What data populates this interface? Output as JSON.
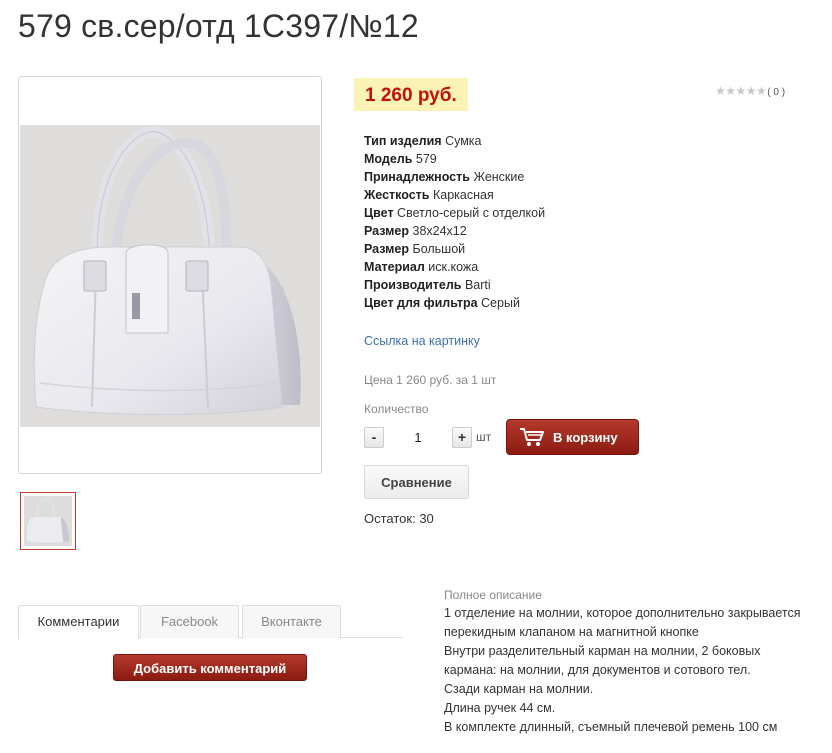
{
  "product": {
    "title": "579 св.сер/отд 1С397/№12",
    "price": "1 260 руб.",
    "rating_stars": "★★★★★",
    "rating_count": "( 0 )"
  },
  "properties": [
    {
      "key": "Тип изделия",
      "value": "Сумка"
    },
    {
      "key": "Модель",
      "value": "579"
    },
    {
      "key": "Принадлежность",
      "value": "Женские"
    },
    {
      "key": "Жесткость",
      "value": "Каркасная"
    },
    {
      "key": "Цвет",
      "value": "Светло-серый с отделкой"
    },
    {
      "key": "Размер",
      "value": "38x24x12"
    },
    {
      "key": "Размер",
      "value": "Большой"
    },
    {
      "key": "Материал",
      "value": "иск.кожа"
    },
    {
      "key": "Производитель",
      "value": "Barti"
    },
    {
      "key": "Цвет для фильтра",
      "value": "Серый"
    }
  ],
  "purchase": {
    "image_link": "Ссылка на картинку",
    "price_per_unit": "Цена 1 260 руб. за 1 шт",
    "quantity_label": "Количество",
    "minus": "-",
    "quantity_value": "1",
    "plus": "+",
    "unit": "шт",
    "cart_button": "В корзину",
    "compare_button": "Сравнение",
    "stock": "Остаток: 30"
  },
  "comments": {
    "tabs": [
      {
        "label": "Комментарии",
        "active": true
      },
      {
        "label": "Facebook",
        "active": false
      },
      {
        "label": "Вконтакте",
        "active": false
      }
    ],
    "add_button": "Добавить комментарий"
  },
  "description": {
    "title": "Полное описание",
    "lines": [
      "1 отделение на молнии, которое дополнительно закрывается",
      "перекидным клапаном на магнитной кнопке",
      "Внутри разделительный карман на молнии, 2 боковых",
      "кармана: на молнии, для документов и сотового тел.",
      "Сзади карман на молнии.",
      "Длина ручек 44 см.",
      "В комплекте длинный, съемный плечевой ремень 100 см"
    ]
  },
  "colors": {
    "accent_red": "#9e2719",
    "price_red": "#c0110e",
    "price_bg": "#fbf3b6",
    "link_blue": "#3d6fb3"
  }
}
